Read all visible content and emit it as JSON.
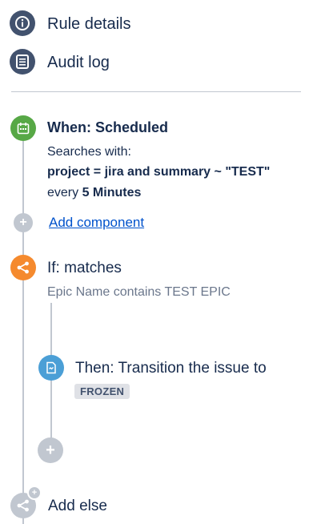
{
  "nav": {
    "rule_details": "Rule details",
    "audit_log": "Audit log"
  },
  "trigger": {
    "title": "When: Scheduled",
    "searches_label": "Searches with:",
    "query": "project = jira and summary ~ \"TEST\"",
    "every_prefix": "every",
    "every_value": "5 Minutes"
  },
  "add_component": "Add component",
  "condition": {
    "title": "If: matches",
    "detail": "Epic Name contains TEST EPIC"
  },
  "action": {
    "title": "Then: Transition the issue to",
    "status": "FROZEN"
  },
  "add_else": "Add else",
  "colors": {
    "trigger": "#57a846",
    "condition": "#f58a2e",
    "action": "#4b9fd6",
    "nav_icon": "#42526e",
    "line": "#c1c7d0",
    "link": "#0052cc"
  }
}
